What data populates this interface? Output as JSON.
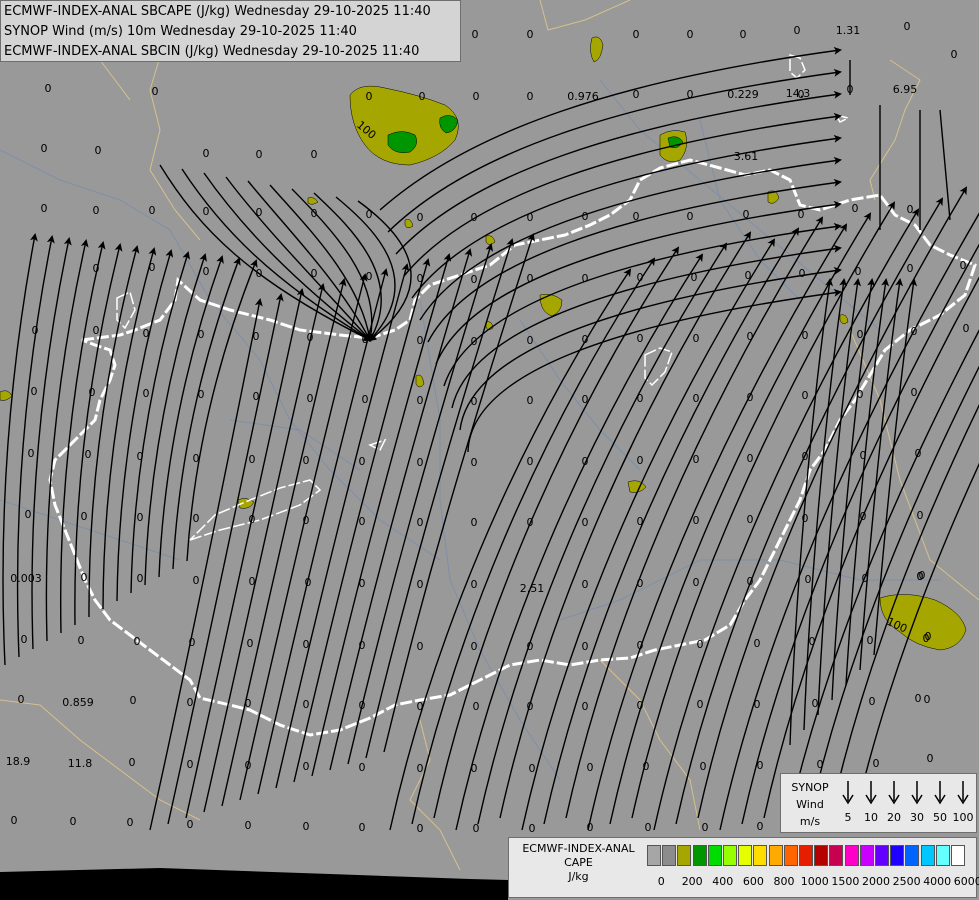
{
  "titles": [
    "ECMWF-INDEX-ANAL SBCAPE (J/kg) Wednesday 29-10-2025 11:40",
    "SYNOP Wind (m/s) 10m Wednesday 29-10-2025 11:40",
    "ECMWF-INDEX-ANAL SBCIN (J/kg) Wednesday 29-10-2025 11:40"
  ],
  "synop_legend": {
    "title": [
      "SYNOP",
      "Wind",
      "m/s"
    ],
    "speeds": [
      "5",
      "10",
      "20",
      "30",
      "50",
      "100"
    ]
  },
  "cape_legend": {
    "title": [
      "ECMWF-INDEX-ANAL",
      "CAPE",
      "J/kg"
    ],
    "colors": [
      "#a6a6a6",
      "#8c8c8c",
      "#a6a600",
      "#009600",
      "#00dc00",
      "#96ff00",
      "#e6ff00",
      "#ffdc00",
      "#ffaa00",
      "#ff6400",
      "#e61e00",
      "#b40000",
      "#c80050",
      "#ff00c8",
      "#c800ff",
      "#6400ff",
      "#1e00ff",
      "#0064ff",
      "#00c8ff",
      "#64ffff",
      "#ffffff"
    ],
    "ticks": [
      "0",
      "200",
      "400",
      "600",
      "800",
      "1000",
      "1500",
      "2000",
      "2500",
      "4000",
      "6000"
    ]
  },
  "map_values": {
    "contour_label": "100",
    "contour_label_east": "100",
    "special": [
      "1.31",
      "0.976",
      "0.229",
      "14.3",
      "6.95",
      "3.61",
      "0.003",
      "2.51",
      "0.859",
      "18.9",
      "11.8"
    ],
    "zero": "0"
  },
  "colors": {
    "background": "#999999",
    "border": "#ffffff",
    "river": "#7f8fa8",
    "streamline": "#000000",
    "cape_low": "#a6a600",
    "cape_mid": "#009600"
  }
}
